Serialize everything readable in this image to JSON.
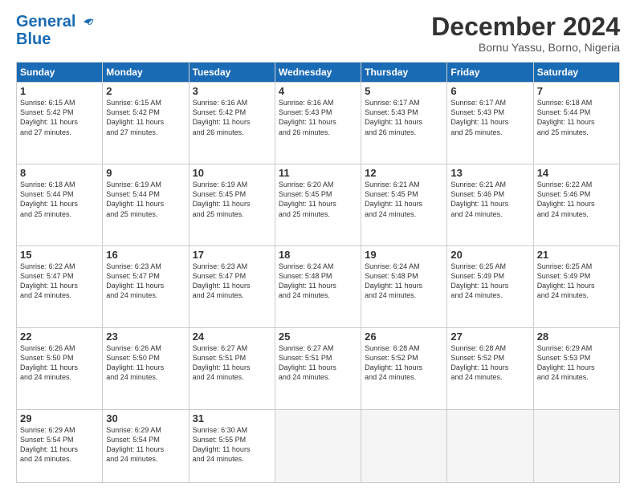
{
  "logo": {
    "line1": "General",
    "line2": "Blue"
  },
  "title": "December 2024",
  "location": "Bornu Yassu, Borno, Nigeria",
  "days_header": [
    "Sunday",
    "Monday",
    "Tuesday",
    "Wednesday",
    "Thursday",
    "Friday",
    "Saturday"
  ],
  "weeks": [
    [
      {
        "num": "1",
        "info": "Sunrise: 6:15 AM\nSunset: 5:42 PM\nDaylight: 11 hours\nand 27 minutes."
      },
      {
        "num": "2",
        "info": "Sunrise: 6:15 AM\nSunset: 5:42 PM\nDaylight: 11 hours\nand 27 minutes."
      },
      {
        "num": "3",
        "info": "Sunrise: 6:16 AM\nSunset: 5:42 PM\nDaylight: 11 hours\nand 26 minutes."
      },
      {
        "num": "4",
        "info": "Sunrise: 6:16 AM\nSunset: 5:43 PM\nDaylight: 11 hours\nand 26 minutes."
      },
      {
        "num": "5",
        "info": "Sunrise: 6:17 AM\nSunset: 5:43 PM\nDaylight: 11 hours\nand 26 minutes."
      },
      {
        "num": "6",
        "info": "Sunrise: 6:17 AM\nSunset: 5:43 PM\nDaylight: 11 hours\nand 25 minutes."
      },
      {
        "num": "7",
        "info": "Sunrise: 6:18 AM\nSunset: 5:44 PM\nDaylight: 11 hours\nand 25 minutes."
      }
    ],
    [
      {
        "num": "8",
        "info": "Sunrise: 6:18 AM\nSunset: 5:44 PM\nDaylight: 11 hours\nand 25 minutes."
      },
      {
        "num": "9",
        "info": "Sunrise: 6:19 AM\nSunset: 5:44 PM\nDaylight: 11 hours\nand 25 minutes."
      },
      {
        "num": "10",
        "info": "Sunrise: 6:19 AM\nSunset: 5:45 PM\nDaylight: 11 hours\nand 25 minutes."
      },
      {
        "num": "11",
        "info": "Sunrise: 6:20 AM\nSunset: 5:45 PM\nDaylight: 11 hours\nand 25 minutes."
      },
      {
        "num": "12",
        "info": "Sunrise: 6:21 AM\nSunset: 5:45 PM\nDaylight: 11 hours\nand 24 minutes."
      },
      {
        "num": "13",
        "info": "Sunrise: 6:21 AM\nSunset: 5:46 PM\nDaylight: 11 hours\nand 24 minutes."
      },
      {
        "num": "14",
        "info": "Sunrise: 6:22 AM\nSunset: 5:46 PM\nDaylight: 11 hours\nand 24 minutes."
      }
    ],
    [
      {
        "num": "15",
        "info": "Sunrise: 6:22 AM\nSunset: 5:47 PM\nDaylight: 11 hours\nand 24 minutes."
      },
      {
        "num": "16",
        "info": "Sunrise: 6:23 AM\nSunset: 5:47 PM\nDaylight: 11 hours\nand 24 minutes."
      },
      {
        "num": "17",
        "info": "Sunrise: 6:23 AM\nSunset: 5:47 PM\nDaylight: 11 hours\nand 24 minutes."
      },
      {
        "num": "18",
        "info": "Sunrise: 6:24 AM\nSunset: 5:48 PM\nDaylight: 11 hours\nand 24 minutes."
      },
      {
        "num": "19",
        "info": "Sunrise: 6:24 AM\nSunset: 5:48 PM\nDaylight: 11 hours\nand 24 minutes."
      },
      {
        "num": "20",
        "info": "Sunrise: 6:25 AM\nSunset: 5:49 PM\nDaylight: 11 hours\nand 24 minutes."
      },
      {
        "num": "21",
        "info": "Sunrise: 6:25 AM\nSunset: 5:49 PM\nDaylight: 11 hours\nand 24 minutes."
      }
    ],
    [
      {
        "num": "22",
        "info": "Sunrise: 6:26 AM\nSunset: 5:50 PM\nDaylight: 11 hours\nand 24 minutes."
      },
      {
        "num": "23",
        "info": "Sunrise: 6:26 AM\nSunset: 5:50 PM\nDaylight: 11 hours\nand 24 minutes."
      },
      {
        "num": "24",
        "info": "Sunrise: 6:27 AM\nSunset: 5:51 PM\nDaylight: 11 hours\nand 24 minutes."
      },
      {
        "num": "25",
        "info": "Sunrise: 6:27 AM\nSunset: 5:51 PM\nDaylight: 11 hours\nand 24 minutes."
      },
      {
        "num": "26",
        "info": "Sunrise: 6:28 AM\nSunset: 5:52 PM\nDaylight: 11 hours\nand 24 minutes."
      },
      {
        "num": "27",
        "info": "Sunrise: 6:28 AM\nSunset: 5:52 PM\nDaylight: 11 hours\nand 24 minutes."
      },
      {
        "num": "28",
        "info": "Sunrise: 6:29 AM\nSunset: 5:53 PM\nDaylight: 11 hours\nand 24 minutes."
      }
    ],
    [
      {
        "num": "29",
        "info": "Sunrise: 6:29 AM\nSunset: 5:54 PM\nDaylight: 11 hours\nand 24 minutes."
      },
      {
        "num": "30",
        "info": "Sunrise: 6:29 AM\nSunset: 5:54 PM\nDaylight: 11 hours\nand 24 minutes."
      },
      {
        "num": "31",
        "info": "Sunrise: 6:30 AM\nSunset: 5:55 PM\nDaylight: 11 hours\nand 24 minutes."
      },
      {
        "num": "",
        "info": ""
      },
      {
        "num": "",
        "info": ""
      },
      {
        "num": "",
        "info": ""
      },
      {
        "num": "",
        "info": ""
      }
    ]
  ]
}
